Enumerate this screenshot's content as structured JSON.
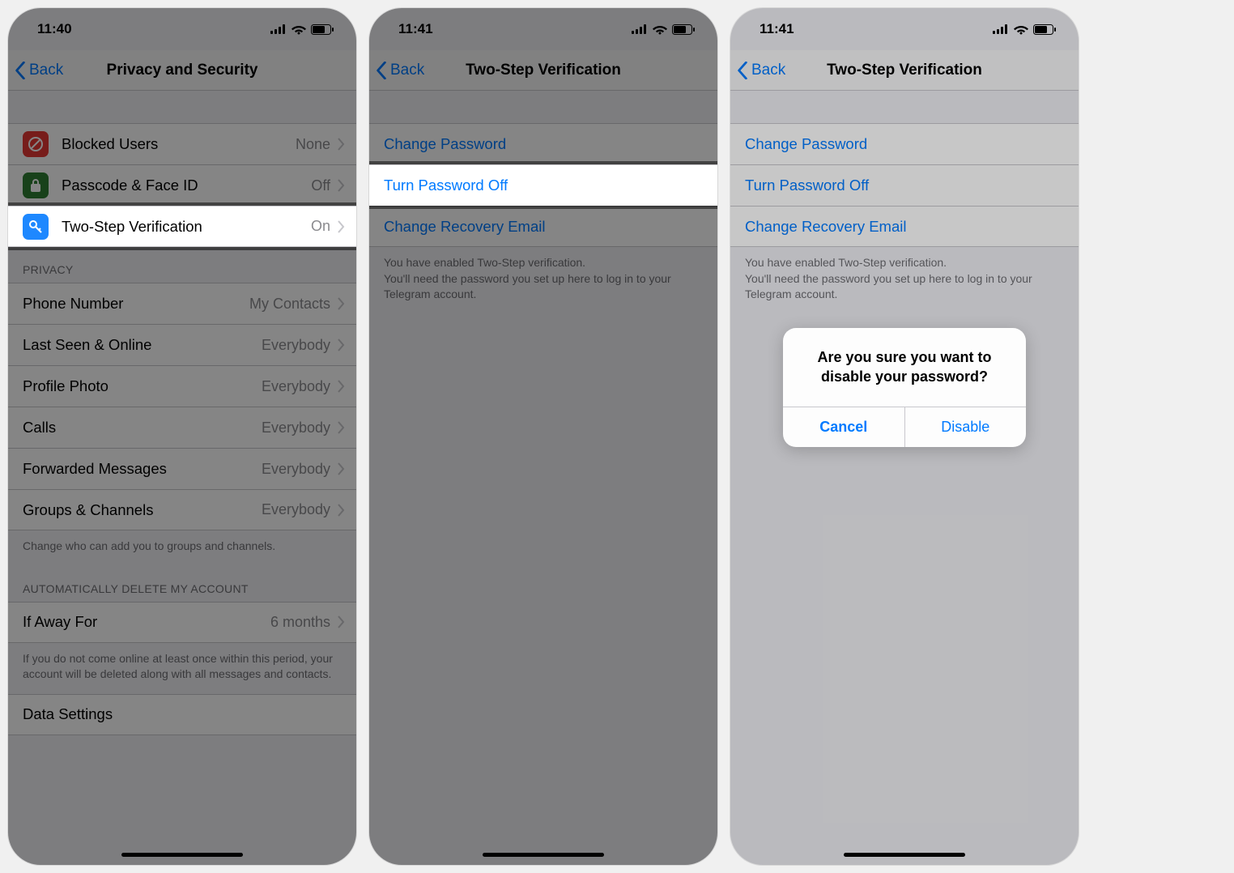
{
  "screen1": {
    "time": "11:40",
    "nav": {
      "back": "Back",
      "title": "Privacy and Security"
    },
    "securityRows": [
      {
        "label": "Blocked Users",
        "value": "None",
        "iconColor": "icon-red"
      },
      {
        "label": "Passcode & Face ID",
        "value": "Off",
        "iconColor": "icon-green"
      },
      {
        "label": "Two-Step Verification",
        "value": "On",
        "iconColor": "icon-blue"
      }
    ],
    "privacyHeader": "PRIVACY",
    "privacyRows": [
      {
        "label": "Phone Number",
        "value": "My Contacts"
      },
      {
        "label": "Last Seen & Online",
        "value": "Everybody"
      },
      {
        "label": "Profile Photo",
        "value": "Everybody"
      },
      {
        "label": "Calls",
        "value": "Everybody"
      },
      {
        "label": "Forwarded Messages",
        "value": "Everybody"
      },
      {
        "label": "Groups & Channels",
        "value": "Everybody"
      }
    ],
    "privacyFooter": "Change who can add you to groups and channels.",
    "deleteHeader": "AUTOMATICALLY DELETE MY ACCOUNT",
    "deleteRow": {
      "label": "If Away For",
      "value": "6 months"
    },
    "deleteFooter": "If you do not come online at least once within this period, your account will be deleted along with all messages and contacts.",
    "dataSettings": "Data Settings"
  },
  "screen2": {
    "time": "11:41",
    "nav": {
      "back": "Back",
      "title": "Two-Step Verification"
    },
    "rows": [
      {
        "label": "Change Password"
      },
      {
        "label": "Turn Password Off"
      },
      {
        "label": "Change Recovery Email"
      }
    ],
    "footer": "You have enabled Two-Step verification.\nYou'll need the password you set up here to log in to your Telegram account."
  },
  "screen3": {
    "time": "11:41",
    "nav": {
      "back": "Back",
      "title": "Two-Step Verification"
    },
    "rows": [
      {
        "label": "Change Password"
      },
      {
        "label": "Turn Password Off"
      },
      {
        "label": "Change Recovery Email"
      }
    ],
    "footer": "You have enabled Two-Step verification.\nYou'll need the password you set up here to log in to your Telegram account.",
    "alert": {
      "message": "Are you sure you want to disable your password?",
      "cancel": "Cancel",
      "confirm": "Disable"
    }
  }
}
